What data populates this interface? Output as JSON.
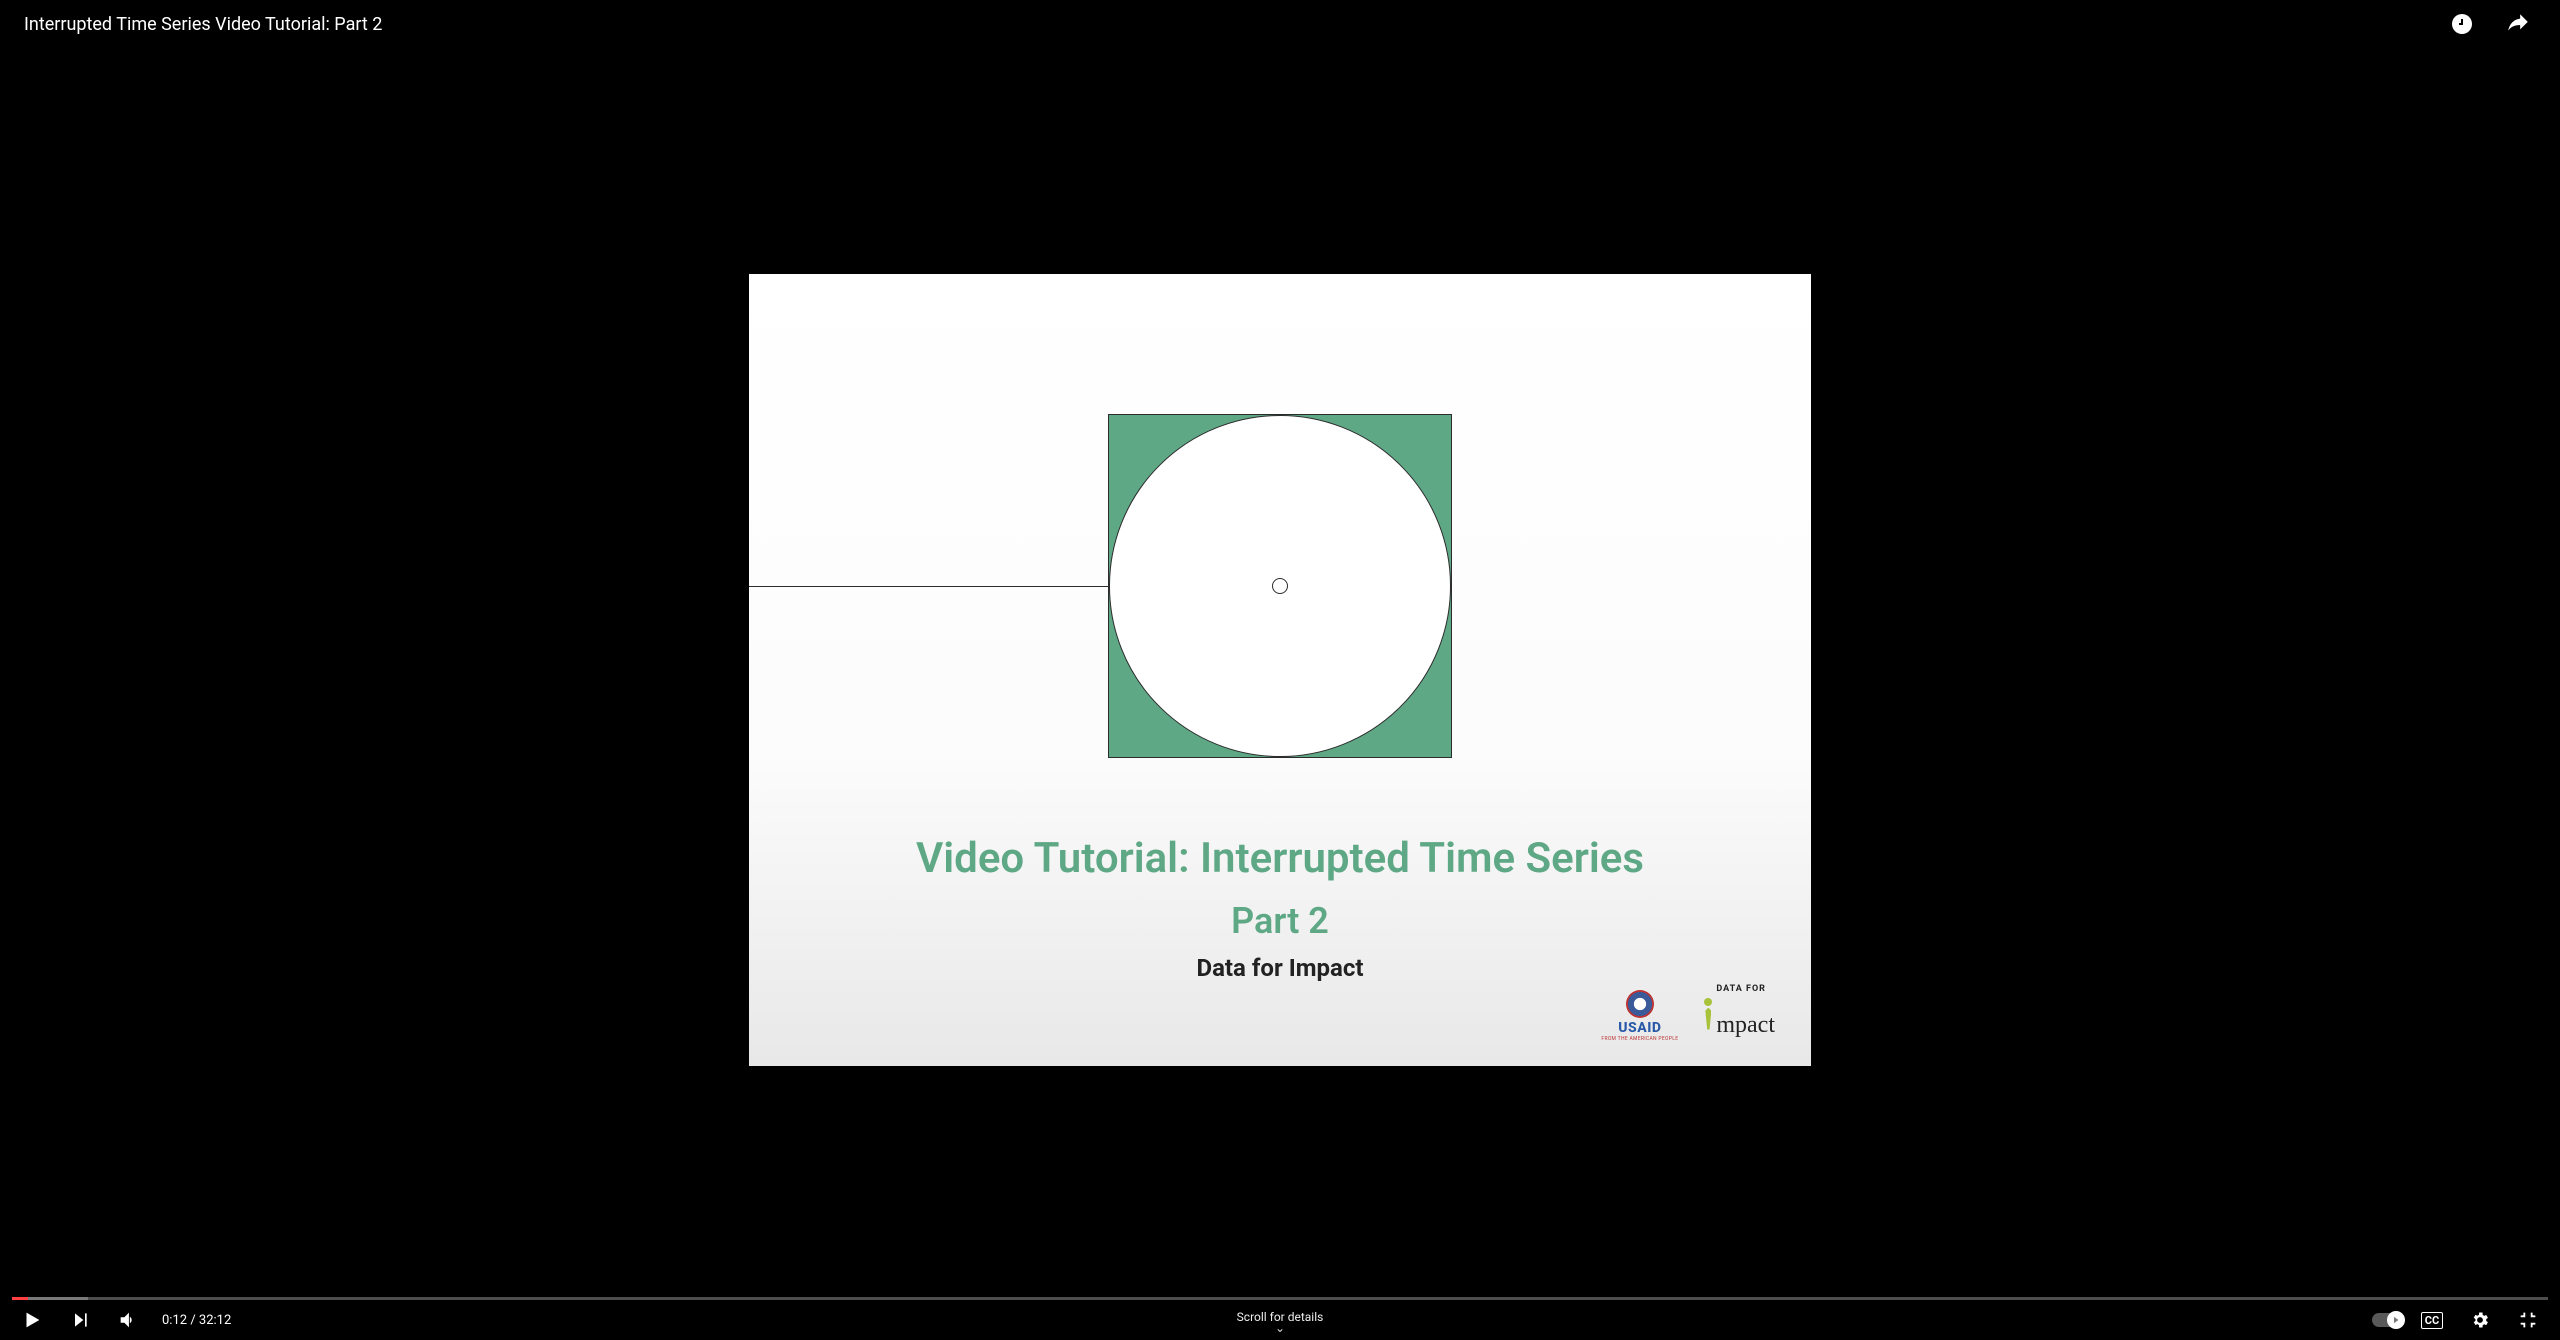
{
  "header": {
    "title": "Interrupted Time Series Video Tutorial: Part 2"
  },
  "slide": {
    "title": "Video Tutorial: Interrupted Time Series",
    "subtitle": "Part 2",
    "org": "Data for Impact",
    "logos": {
      "usaid_text": "USAID",
      "usaid_sub": "FROM THE AMERICAN PEOPLE",
      "d4i_prefix": "DATA FOR",
      "d4i_main": "mpact"
    }
  },
  "playback": {
    "current_time": "0:12",
    "duration": "32:12",
    "progress_percent": 0.62,
    "loaded_percent": 3
  },
  "scroll_hint": "Scroll for details",
  "colors": {
    "accent_green": "#5ea886",
    "progress_red": "#ff0000"
  }
}
